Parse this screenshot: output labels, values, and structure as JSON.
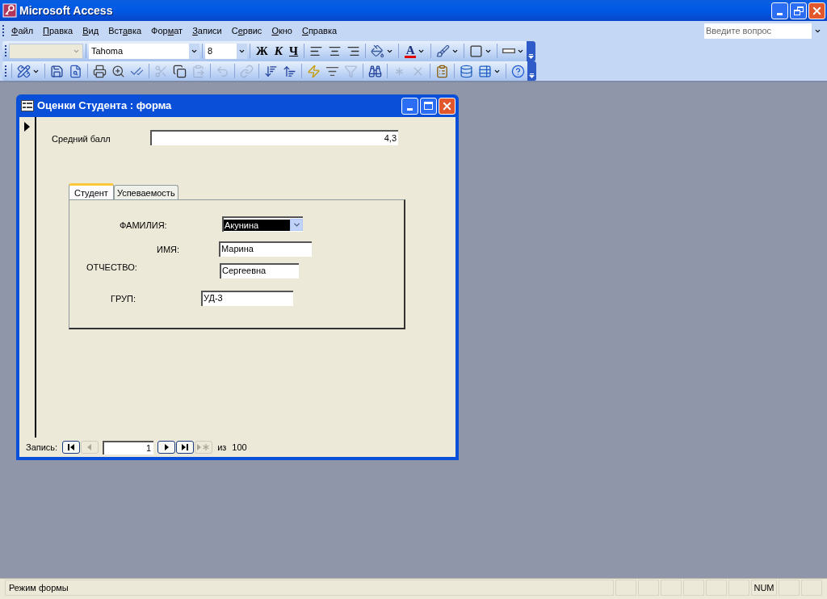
{
  "app_window": {
    "title": "Microsoft Access"
  },
  "menu": [
    {
      "key": "Ф",
      "post": "айл"
    },
    {
      "key": "П",
      "post": "равка"
    },
    {
      "key": "В",
      "post": "ид"
    },
    {
      "pre": "Вст",
      "key": "а",
      "post": "вка"
    },
    {
      "pre": "Фор",
      "key": "м",
      "post": "ат"
    },
    {
      "key": "З",
      "post": "аписи"
    },
    {
      "pre": "С",
      "key": "е",
      "post": "рвис"
    },
    {
      "key": "О",
      "post": "кно"
    },
    {
      "key": "С",
      "post": "правка"
    }
  ],
  "help_box": {
    "placeholder": "Введите вопрос"
  },
  "format_toolbar": {
    "font": "Tahoma",
    "size": "8",
    "groups": [
      [
        {
          "kind": "bold",
          "label": "Ж",
          "disabled": false
        },
        {
          "kind": "italic",
          "label": "К",
          "disabled": false
        },
        {
          "kind": "underline",
          "label": "Ч",
          "disabled": false
        }
      ],
      [
        {
          "kind": "align-left",
          "disabled": false
        },
        {
          "kind": "align-center",
          "disabled": false
        },
        {
          "kind": "align-right",
          "disabled": false
        }
      ],
      [
        {
          "kind": "fill-color",
          "disabled": false
        }
      ],
      [
        {
          "kind": "font-color",
          "label": "A",
          "disabled": false
        }
      ],
      [
        {
          "kind": "line-color",
          "disabled": false
        }
      ],
      [
        {
          "kind": "border",
          "disabled": false
        }
      ],
      [
        {
          "kind": "line-width",
          "disabled": false
        }
      ]
    ]
  },
  "form_toolbar": {
    "groups": [
      [
        {
          "kind": "view",
          "disabled": false
        }
      ],
      [
        {
          "kind": "save",
          "disabled": false
        },
        {
          "kind": "file-search",
          "disabled": false
        }
      ],
      [
        {
          "kind": "print",
          "disabled": false
        },
        {
          "kind": "preview",
          "disabled": false
        },
        {
          "kind": "spelling",
          "disabled": false
        }
      ],
      [
        {
          "kind": "cut",
          "disabled": true
        },
        {
          "kind": "copy",
          "disabled": false
        },
        {
          "kind": "paste",
          "disabled": true
        }
      ],
      [
        {
          "kind": "undo",
          "disabled": true
        }
      ],
      [
        {
          "kind": "hyperlink",
          "disabled": true
        }
      ],
      [
        {
          "kind": "sort-asc",
          "disabled": false
        },
        {
          "kind": "sort-desc",
          "disabled": false
        }
      ],
      [
        {
          "kind": "filter-selection",
          "disabled": false
        },
        {
          "kind": "filter-form",
          "disabled": false
        },
        {
          "kind": "filter-apply",
          "disabled": true
        }
      ],
      [
        {
          "kind": "find",
          "disabled": false
        }
      ],
      [
        {
          "kind": "new-record",
          "disabled": true
        },
        {
          "kind": "delete-record",
          "disabled": true
        }
      ],
      [
        {
          "kind": "properties",
          "disabled": false
        }
      ],
      [
        {
          "kind": "database-window",
          "disabled": false
        },
        {
          "kind": "new-object",
          "disabled": false
        }
      ],
      [
        {
          "kind": "help",
          "disabled": false
        }
      ]
    ]
  },
  "form_window": {
    "title": "Оценки Студента : форма",
    "average": {
      "label": "Средний балл",
      "value": "4,3"
    },
    "tabs": [
      {
        "label": "Студент",
        "selected": true
      },
      {
        "label": "Успеваемость",
        "selected": false
      }
    ],
    "fields": [
      {
        "kind": "combo",
        "label": "ФАМИЛИЯ:",
        "value": "Акунина",
        "highlighted": true
      },
      {
        "kind": "text",
        "label": "ИМЯ:",
        "value": "Марина",
        "highlighted": false
      },
      {
        "kind": "text",
        "label": "ОТЧЕСТВО:",
        "value": "Сергеевна",
        "highlighted": false
      },
      {
        "kind": "text",
        "label": "ГРУП:",
        "value": "УД-3",
        "highlighted": false
      }
    ],
    "navigation": {
      "label": "Запись:",
      "current": "1",
      "of_label": "из",
      "total": "100",
      "buttons": [
        {
          "kind": "first",
          "disabled": false
        },
        {
          "kind": "prev",
          "disabled": true
        },
        {
          "kind": "next",
          "disabled": false
        },
        {
          "kind": "last",
          "disabled": false
        },
        {
          "kind": "new",
          "disabled": true
        }
      ]
    }
  },
  "status_bar": {
    "mode": "Режим формы",
    "num_lock": "NUM"
  }
}
